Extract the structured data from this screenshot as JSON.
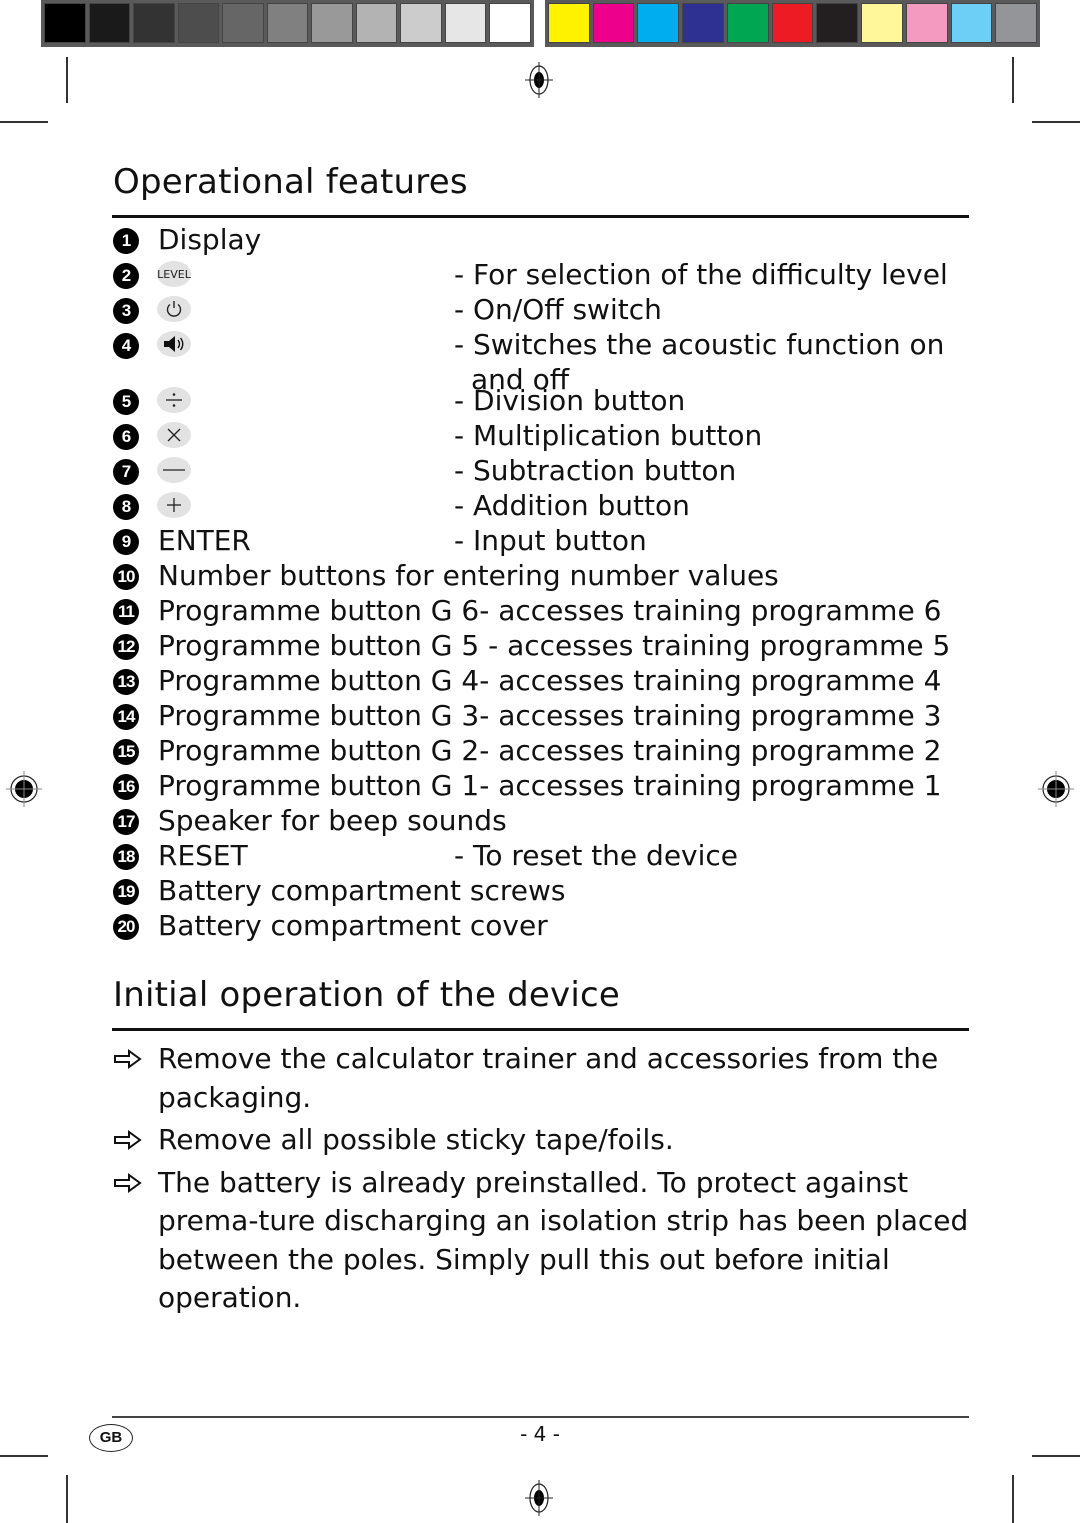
{
  "colorbar": {
    "grayscale": [
      "#000000",
      "#1a1a1a",
      "#333333",
      "#4d4d4d",
      "#666666",
      "#808080",
      "#999999",
      "#b3b3b3",
      "#cccccc",
      "#e6e6e6",
      "#ffffff"
    ],
    "process": [
      "#fff200",
      "#ec008c",
      "#00aeef",
      "#2e3192",
      "#00a651",
      "#ed1c24",
      "#231f20",
      "#fff799",
      "#f49ac1",
      "#6dcff6",
      "#939598"
    ]
  },
  "sections": {
    "features_title": "Operational features",
    "initial_title": "Initial operation of the device"
  },
  "features": [
    {
      "n": "1",
      "label": "Display",
      "desc": ""
    },
    {
      "n": "2",
      "icon": "level-key-icon",
      "icon_text": "LEVEL",
      "desc": "- For selection of the difficulty level"
    },
    {
      "n": "3",
      "icon": "power-key-icon",
      "desc": "- On/Off switch"
    },
    {
      "n": "4",
      "icon": "speaker-key-icon",
      "desc": "- Switches the acoustic function on and off"
    },
    {
      "n": "5",
      "icon": "divide-key-icon",
      "desc": "- Division button"
    },
    {
      "n": "6",
      "icon": "multiply-key-icon",
      "desc": "- Multiplication button"
    },
    {
      "n": "7",
      "icon": "minus-key-icon",
      "desc": "- Subtraction button"
    },
    {
      "n": "8",
      "icon": "plus-key-icon",
      "desc": "- Addition button"
    },
    {
      "n": "9",
      "label": "ENTER",
      "desc": "- Input button"
    },
    {
      "n": "10",
      "label": "Number buttons for entering number values"
    },
    {
      "n": "11",
      "label": "Programme button G 6",
      "desc": "- accesses training programme 6"
    },
    {
      "n": "12",
      "label": "Programme button G 5 ",
      "desc": "- accesses training programme 5"
    },
    {
      "n": "13",
      "label": "Programme button G 4",
      "desc": "- accesses training programme 4"
    },
    {
      "n": "14",
      "label": "Programme button G 3",
      "desc": "- accesses training programme 3"
    },
    {
      "n": "15",
      "label": "Programme button G 2",
      "desc": "- accesses training programme 2"
    },
    {
      "n": "16",
      "label": "Programme button G 1",
      "desc": "- accesses training programme 1"
    },
    {
      "n": "17",
      "label": "Speaker for beep sounds"
    },
    {
      "n": "18",
      "label": "RESET",
      "desc": "- To reset the device"
    },
    {
      "n": "19",
      "label": "Battery compartment screws"
    },
    {
      "n": "20",
      "label": "Battery compartment cover"
    }
  ],
  "initial_operation": [
    "Remove the calculator trainer and accessories from the packaging.",
    "Remove all possible sticky tape/foils.",
    "The battery is already preinstalled. To protect against prema-ture discharging an isolation strip has been placed between the poles. Simply pull this out before initial operation."
  ],
  "footer": {
    "language_badge": "GB",
    "page_number": "- 4 -"
  }
}
